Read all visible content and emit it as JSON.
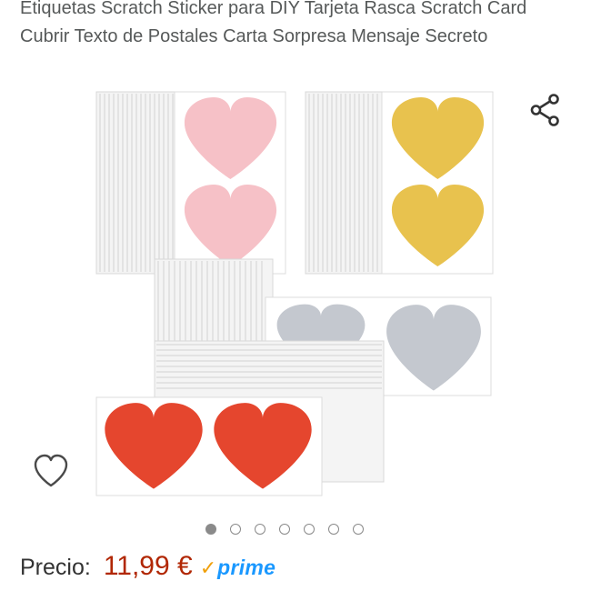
{
  "product": {
    "title": "Etiquetas Scratch Sticker para DIY Tarjeta Rasca Scratch Card Cubrir Texto de Postales Carta Sorpresa Mensaje Secreto"
  },
  "actions": {
    "share_icon": "share-icon",
    "wishlist_icon": "heart-outline-icon"
  },
  "gallery": {
    "image_count": 7,
    "active_index": 0,
    "sticker_colors": {
      "pink": "#f6c1c7",
      "gold": "#e8c24e",
      "silver": "#c4c8cf",
      "red": "#e5462e"
    }
  },
  "pricing": {
    "label": "Precio:",
    "value": "11,99 €",
    "badge_check": "✓",
    "badge_text": "prime",
    "price_color": "#b12704",
    "prime_color": "#1a98ff"
  }
}
